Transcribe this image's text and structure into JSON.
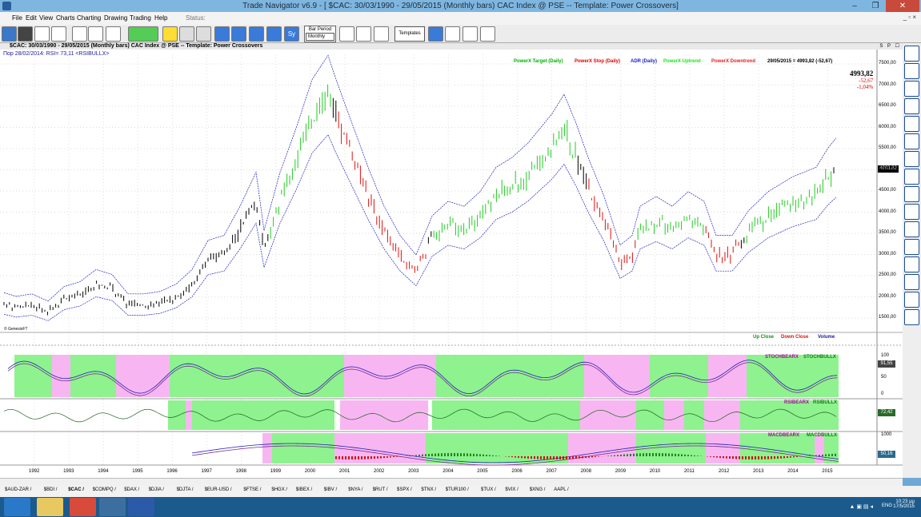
{
  "window": {
    "title": "Trade Navigator v6.9 - [ $CAC:  30/03/1990 - 29/05/2015  (Monthly bars)   CAC Index @ PSE  --  Template: Power Crossovers]",
    "min": "–",
    "max": "❐",
    "close": "✕"
  },
  "menu": {
    "items": [
      "File",
      "Edit",
      "View",
      "Charts",
      "Charting",
      "Drawing",
      "Trading",
      "Help"
    ],
    "status": "Status:",
    "mdi": "_ ▫ ×"
  },
  "toolbar": {
    "bar_period_label": "Bar Period",
    "bar_period_value": "Monthly",
    "templates_label": "Templates"
  },
  "chart": {
    "header": "$CAC:  30/03/1990 - 29/05/2015  (Monthly bars)   CAC Index @ PSE  --  Template: Power Crossovers",
    "header_buttons": "S P ☐",
    "rsi_line": "Пор 28/02/2014:  RSI= 73,11  <RSIBULLX>",
    "watermark": "© GenesisFT",
    "legend": [
      {
        "text": "PowerX Target (Daily)",
        "color": "#00b000"
      },
      {
        "text": "PowerX Stop (Daily)",
        "color": "#e00000"
      },
      {
        "text": "ADR (Daily)",
        "color": "#2020c0"
      },
      {
        "text": "PowerX Uptrend",
        "color": "#20e020"
      },
      {
        "text": "PowerX Downtrend",
        "color": "#e02020"
      }
    ],
    "date_readout": "29/05/2015 = 4993,82 (-52,67)",
    "readout": {
      "value": "4993,82",
      "change": "-52,67",
      "pct": "-1,04%"
    },
    "price_tag": "4993,82",
    "y_ticks": [
      "7500,00",
      "7000,00",
      "6500,00",
      "6000,00",
      "5500,00",
      "5000,00",
      "4500,00",
      "4000,00",
      "3500,00",
      "3000,00",
      "2500,00",
      "2000,00",
      "1500,00"
    ],
    "volume_legend": [
      "Up Close",
      "Down Close",
      "Volume"
    ],
    "x_years": [
      "1992",
      "1993",
      "1994",
      "1995",
      "1996",
      "1997",
      "1998",
      "1999",
      "2000",
      "2001",
      "2002",
      "2003",
      "2004",
      "2005",
      "2006",
      "2007",
      "2008",
      "2009",
      "2010",
      "2011",
      "2012",
      "2013",
      "2014",
      "2015"
    ]
  },
  "indicators": {
    "stoch": {
      "label_bear": "STOCHBEARX",
      "label_bull": "STOCHBULLX",
      "value": "91,55",
      "ticks": [
        "100",
        "50",
        "0"
      ]
    },
    "rsi": {
      "label_bear": "RSIBEARX",
      "label_bull": "RSIBULLX",
      "value": "72,42"
    },
    "macd": {
      "label_bear": "MACDBEARX",
      "label_bull": "MACDBULLX",
      "value": "50,16",
      "tick": "1000"
    }
  },
  "colors": {
    "up": "#22cc22",
    "down": "#e01010",
    "neutral": "#000000",
    "band": "#2020c0",
    "bull_bg": "#8ef28e",
    "bear_bg": "#f7b6f2"
  },
  "tabs": [
    "$AUD-ZAR",
    "$BDI",
    "$CAC",
    "$COMPQ",
    "$DAX",
    "$DJIA",
    "$DJTA",
    "$EUR-USD",
    "$FTSE",
    "$HGX",
    "$IBEX",
    "$IBV",
    "$NYA",
    "$RUT",
    "$SPX",
    "$TNX",
    "$TUR100",
    "$TUX",
    "$VIX",
    "$XNG",
    "AAPL"
  ],
  "tray": {
    "time": "10:23 μμ",
    "date": "17/5/2015",
    "lang": "ENG"
  }
}
